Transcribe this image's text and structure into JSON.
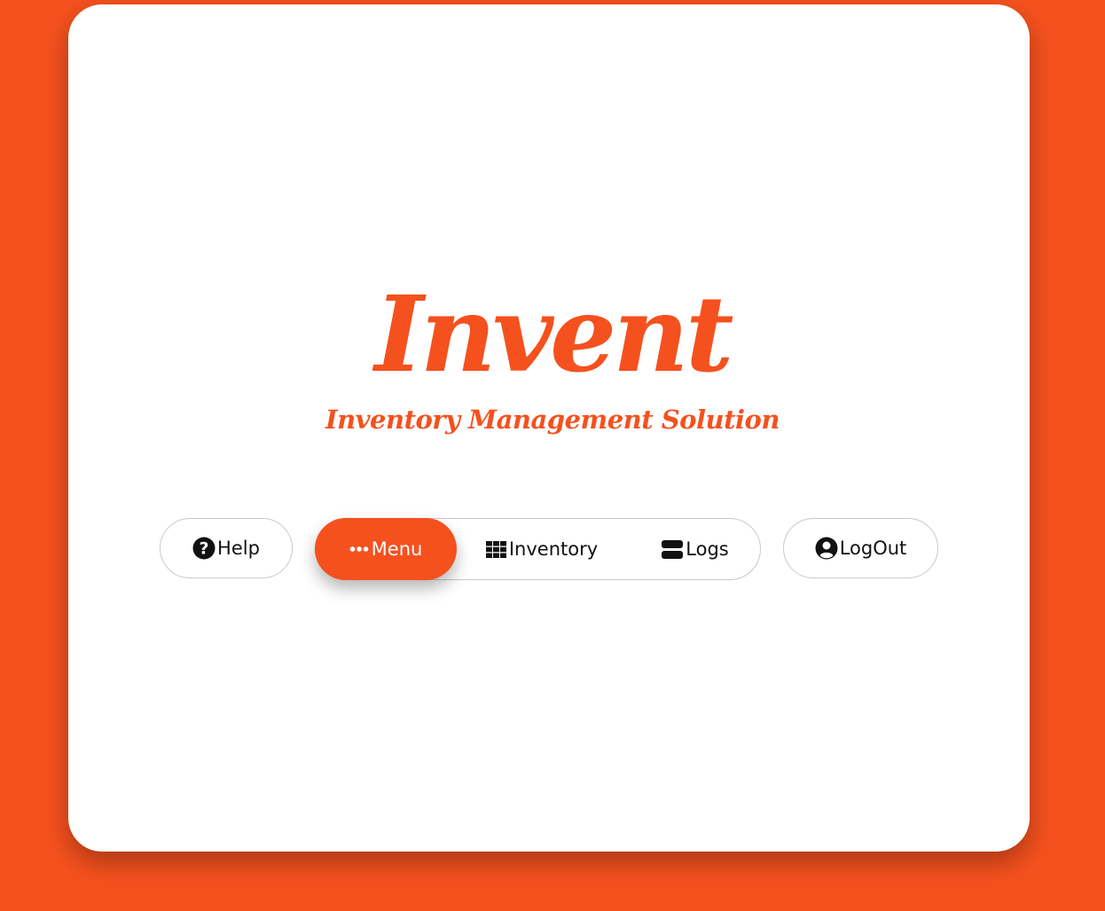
{
  "brand": {
    "logo_text": "Invent",
    "tagline": "Inventory Management Solution",
    "accent_color": "#f5511e"
  },
  "nav": {
    "help": {
      "label": "Help",
      "icon": "question-circle-icon"
    },
    "menu": {
      "label": "Menu",
      "icon": "ellipsis-icon",
      "active": true
    },
    "inventory": {
      "label": "Inventory",
      "icon": "grid-icon"
    },
    "logs": {
      "label": "Logs",
      "icon": "server-icon"
    },
    "logout": {
      "label": "LogOut",
      "icon": "user-circle-icon"
    }
  }
}
